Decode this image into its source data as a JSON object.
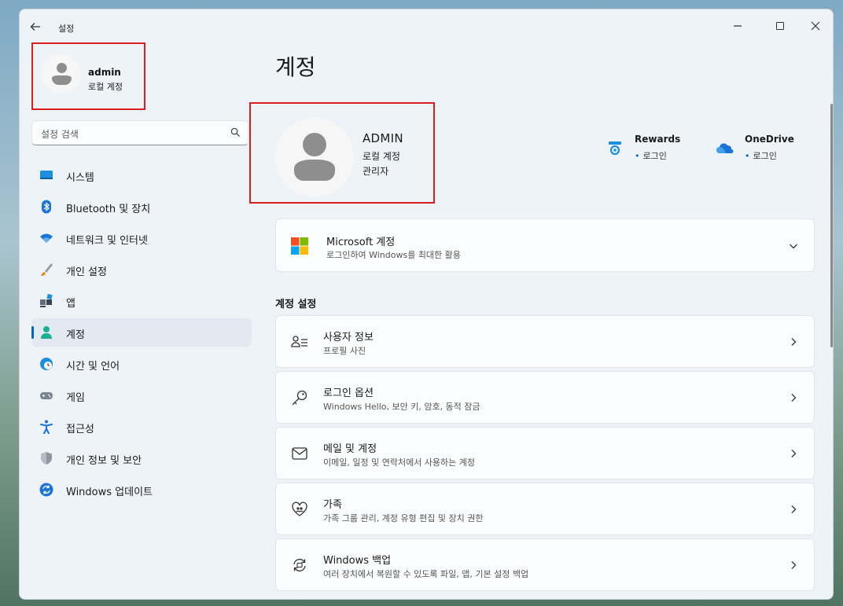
{
  "window": {
    "title": "설정"
  },
  "sidebar": {
    "user": {
      "name": "admin",
      "account_type": "로컬 계정"
    },
    "search": {
      "placeholder": "설정 검색"
    },
    "items": [
      {
        "label": "시스템",
        "icon": "monitor-icon"
      },
      {
        "label": "Bluetooth 및 장치",
        "icon": "bluetooth-icon"
      },
      {
        "label": "네트워크 및 인터넷",
        "icon": "wifi-icon"
      },
      {
        "label": "개인 설정",
        "icon": "brush-icon"
      },
      {
        "label": "앱",
        "icon": "apps-icon"
      },
      {
        "label": "계정",
        "icon": "person-icon",
        "selected": true
      },
      {
        "label": "시간 및 언어",
        "icon": "globe-clock-icon"
      },
      {
        "label": "게임",
        "icon": "gamepad-icon"
      },
      {
        "label": "접근성",
        "icon": "accessibility-icon"
      },
      {
        "label": "개인 정보 및 보안",
        "icon": "shield-icon"
      },
      {
        "label": "Windows 업데이트",
        "icon": "update-icon"
      }
    ]
  },
  "main": {
    "title": "계정",
    "profile": {
      "name": "ADMIN",
      "account_type": "로컬 계정",
      "role": "관리자"
    },
    "services": [
      {
        "name": "Rewards",
        "status": "로그인",
        "icon": "rewards-icon"
      },
      {
        "name": "OneDrive",
        "status": "로그인",
        "icon": "onedrive-icon"
      }
    ],
    "microsoft_account": {
      "title": "Microsoft 계정",
      "subtitle": "로그인하여 Windows를 최대한 활용",
      "icon": "microsoft-logo-icon"
    },
    "section_title": "계정 설정",
    "settings": [
      {
        "title": "사용자 정보",
        "subtitle": "프로필 사진",
        "icon": "user-info-icon"
      },
      {
        "title": "로그인 옵션",
        "subtitle": "Windows Hello, 보안 키, 암호, 동적 잠금",
        "icon": "key-icon"
      },
      {
        "title": "메일 및 계정",
        "subtitle": "이메일, 일정 및 연락처에서 사용하는 계정",
        "icon": "mail-icon"
      },
      {
        "title": "가족",
        "subtitle": "가족 그룹 관리, 계정 유형 편집 및 장치 권한",
        "icon": "family-heart-icon"
      },
      {
        "title": "Windows 백업",
        "subtitle": "여러 장치에서 복원할 수 있도록 파일, 앱, 기본 설정 백업",
        "icon": "backup-icon"
      }
    ]
  },
  "colors": {
    "accent": "#0067c0",
    "highlight_border": "#d81f1f",
    "window_bg": "#eef3f8"
  }
}
